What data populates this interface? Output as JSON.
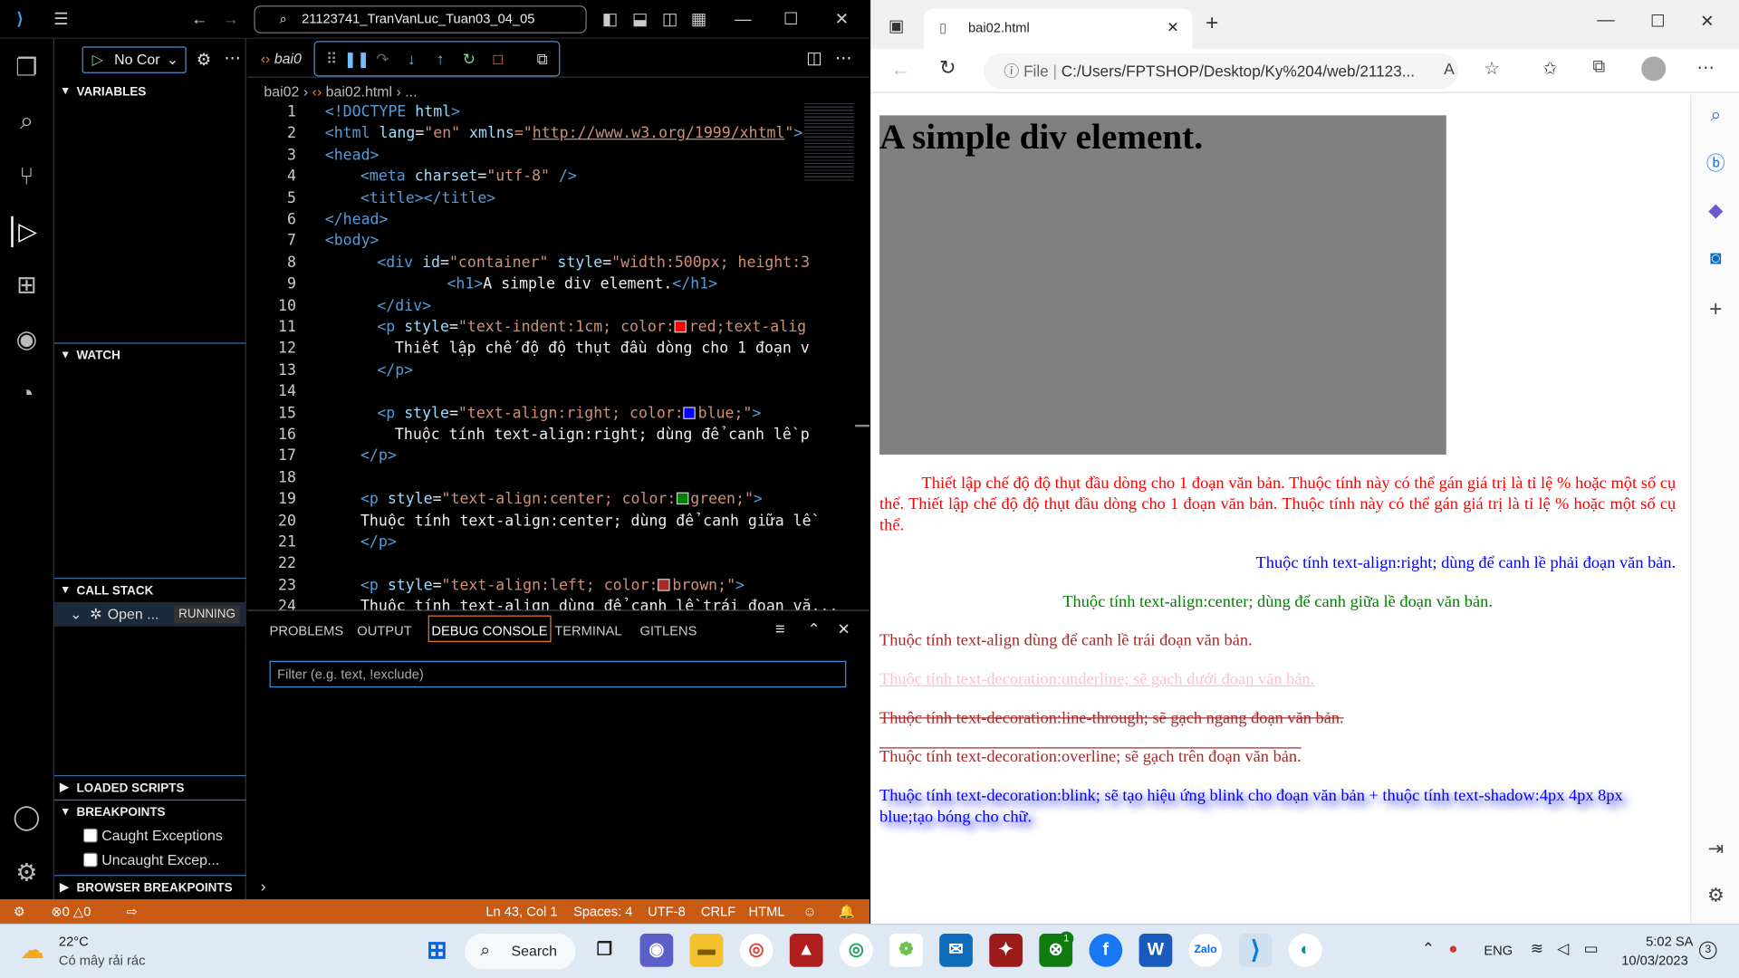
{
  "colors": {
    "statusbar": "#c85a14",
    "accent": "#3a8fd6",
    "vscode_bg": "#000000",
    "gray_box": "#808080"
  },
  "vscode": {
    "title": "21123741_TranVanLuc_Tuan03_04_05",
    "run_config": "No Cor",
    "sidebar": {
      "variables": "VARIABLES",
      "watch": "WATCH",
      "call_stack": "CALL STACK",
      "call_item": "Open ...",
      "call_status": "RUNNING",
      "loaded_scripts": "LOADED SCRIPTS",
      "breakpoints": "BREAKPOINTS",
      "bp_caught": "Caught Exceptions",
      "bp_uncaught": "Uncaught Excep...",
      "browser_bp": "BROWSER BREAKPOINTS"
    },
    "tab_label": "bai0",
    "breadcrumb": {
      "folder": "bai02",
      "file": "bai02.html",
      "rest": "..."
    },
    "code": {
      "l1": {
        "a": "<!DOCTYPE",
        "b": " html",
        "c": ">"
      },
      "l2": {
        "a": "<html ",
        "b": "lang",
        "c": "=",
        "d": "\"en\"",
        "e": " xmlns",
        "f": "=\"",
        "g": "http://www.w3.org/1999/xhtml",
        "h": "\"",
        "i": ">"
      },
      "l3": "<head>",
      "l4": {
        "a": "<meta ",
        "b": "charset",
        "c": "=",
        "d": "\"utf-8\"",
        "e": " />"
      },
      "l5": "<title></title>",
      "l6": "</head>",
      "l7": "<body>",
      "l8": {
        "a": "<div ",
        "b": "id",
        "c": "=",
        "d": "\"container\"",
        "e": " style",
        "f": "=",
        "g": "\"width:500px; height:3"
      },
      "l9": {
        "a": "<h1>",
        "b": "A simple div element.",
        "c": "</h1>"
      },
      "l10": "</div>",
      "l11": {
        "a": "<p ",
        "b": "style",
        "c": "=",
        "d": "\"text-indent:1cm; color:",
        "e": "red;text-alig"
      },
      "l12": "Thiết lập chế độ độ thụt đầu dòng cho 1 đoạn v",
      "l13": "</p>",
      "l15": {
        "a": "<p ",
        "b": "style",
        "c": "=",
        "d": "\"text-align:right; color:",
        "e": "blue;\"",
        "f": ">"
      },
      "l16": "Thuộc tính text-align:right; dùng để canh lề p",
      "l17": "</p>",
      "l19": {
        "a": "<p ",
        "b": "style",
        "c": "=",
        "d": "\"text-align:center; color:",
        "e": "green;\"",
        "f": ">"
      },
      "l20": "Thuộc tính text-align:center; dùng để canh giữa lề",
      "l21": "</p>",
      "l23": {
        "a": "<p ",
        "b": "style",
        "c": "=",
        "d": "\"text-align:left; color:",
        "e": "brown;\"",
        "f": ">"
      },
      "l24": "Thuộc tính text-align dùng để canh lề trái đoạn vă..."
    },
    "panel": {
      "tabs": [
        "PROBLEMS",
        "OUTPUT",
        "DEBUG CONSOLE",
        "TERMINAL",
        "GITLENS"
      ],
      "filter_placeholder": "Filter (e.g. text, !exclude)"
    },
    "status": {
      "errors": "0",
      "warnings": "0",
      "position": "Ln 43, Col 1",
      "spaces": "Spaces: 4",
      "encoding": "UTF-8",
      "eol": "CRLF",
      "language": "HTML"
    }
  },
  "edge": {
    "tab_title": "bai02.html",
    "url_scheme": "File",
    "url": "C:/Users/FPTSHOP/Desktop/Ky%204/web/21123...",
    "page": {
      "h1": "A simple div element.",
      "p_indent": "Thiết lập chế độ độ thụt đầu dòng cho 1 đoạn văn bản. Thuộc tính này có thể gán giá trị là tỉ lệ % hoặc một số cụ thể. Thiết lập chế độ độ thụt đầu dòng cho 1 đoạn văn bản. Thuộc tính này có thể gán giá trị là tỉ lệ % hoặc một số cụ thể.",
      "p_right": "Thuộc tính text-align:right; dùng để canh lề phải đoạn văn bản.",
      "p_center": "Thuộc tính text-align:center; dùng để canh giữa lề đoạn văn bản.",
      "p_left": "Thuộc tính text-align dùng để canh lề trái đoạn văn bản.",
      "p_underline": "Thuộc tính text-decoration:underline; sẽ gạch dưới đoạn văn bản.",
      "p_strike": "Thuộc tính text-decoration:line-through; sẽ gạch ngang đoạn văn bản.",
      "p_overline": "Thuộc tính text-decoration:overline; sẽ gạch trên đoạn văn bản.",
      "p_blink": "Thuộc tính text-decoration:blink; sẽ tạo hiệu ứng blink cho đoạn văn bản + thuộc tính text-shadow:4px 4px 8px blue;tạo bóng cho chữ."
    }
  },
  "taskbar": {
    "weather_temp": "22°C",
    "weather_desc": "Có mây rải rác",
    "search": "Search",
    "lang": "ENG",
    "time": "5:02 SA",
    "date": "10/03/2023",
    "notif": "3",
    "badge_xbox": "1"
  }
}
